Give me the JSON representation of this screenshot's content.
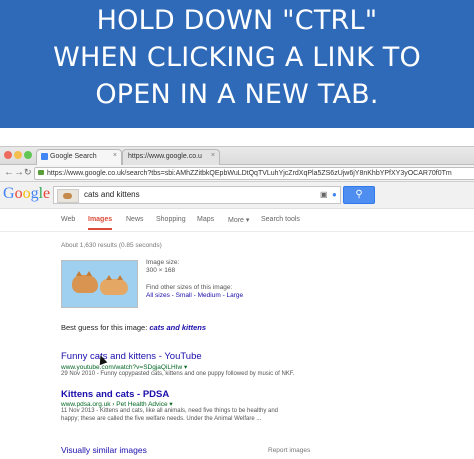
{
  "banner": {
    "lines": [
      "HOLD DOWN \"CTRL\"",
      "WHEN CLICKING A LINK TO",
      "OPEN IN A NEW TAB."
    ]
  },
  "browser": {
    "tabs": [
      {
        "label": "Google Search"
      },
      {
        "label": "https://www.google.co.u"
      }
    ],
    "address": "https://www.google.co.uk/search?tbs=sbi:AMhZZitbkQEpbWuLDtQqTVLuhYjcZrdXqPla5ZS6zUjw6jY8nKhbYPfXY3yOCAR70f0Tm"
  },
  "google": {
    "logo_letters": [
      {
        "ch": "G",
        "color": "#4285f4"
      },
      {
        "ch": "o",
        "color": "#ea4335"
      },
      {
        "ch": "o",
        "color": "#fbbc05"
      },
      {
        "ch": "g",
        "color": "#4285f4"
      },
      {
        "ch": "l",
        "color": "#34a853"
      },
      {
        "ch": "e",
        "color": "#ea4335"
      }
    ],
    "query": "cats and kittens",
    "nav_tabs": [
      "Web",
      "Images",
      "News",
      "Shopping",
      "Maps",
      "More ▾",
      "Search tools"
    ],
    "active_tab": "Images",
    "stats": "About 1,630 results (0.85 seconds)",
    "image_info": {
      "size_label": "Image size:",
      "size_value": "300 × 168",
      "other_sizes": "Find other sizes of this image:",
      "size_links": "All sizes - Small - Medium - Large"
    },
    "best_guess_label": "Best guess for this image: ",
    "best_guess_value": "cats and kittens",
    "results": [
      {
        "title": "Funny cats and kittens - YouTube",
        "url": "www.youtube.com/watch?v=SDgjaQiLHIw ▾",
        "snippet": "29 Nov 2010 - Funny copypasted cats, kittens and one puppy followed by music of NKF."
      },
      {
        "title": "Kittens and cats - PDSA",
        "url": "www.pdsa.org.uk › Pet Health Advice ▾",
        "snippet_line1": "11 Nov 2013 - Kittens and cats, like all animals, need five things to be healthy and",
        "snippet_line2": "happy; these are called the five welfare needs. Under the Animal Welfare ..."
      }
    ],
    "visually_similar": "Visually similar images",
    "report": "Report images"
  }
}
